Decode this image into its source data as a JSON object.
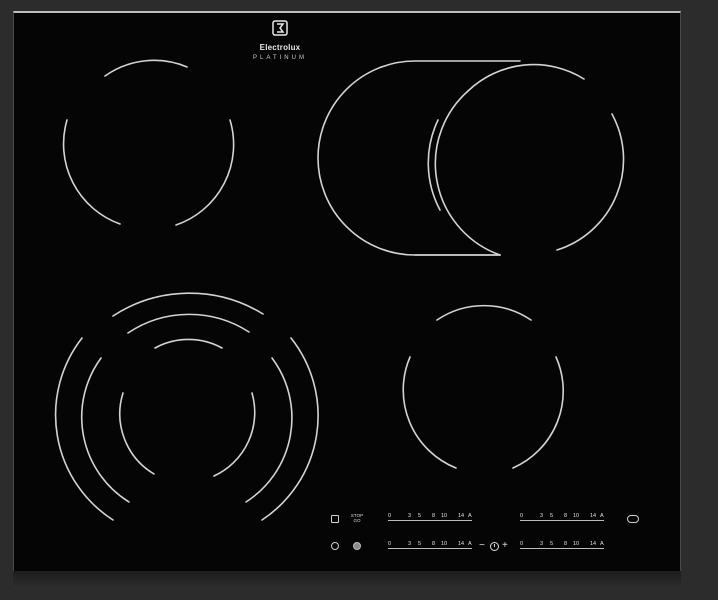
{
  "brand": {
    "name": "Electrolux",
    "series": "PLATINUM"
  },
  "zones": [
    {
      "id": "rear-left",
      "type": "single"
    },
    {
      "id": "rear-right",
      "type": "oval-extension"
    },
    {
      "id": "front-left",
      "type": "triple"
    },
    {
      "id": "front-right",
      "type": "single"
    }
  ],
  "controls": {
    "stop_label": "STOP",
    "stop_sub": "GO",
    "sliders": [
      {
        "id": "slider-top-left",
        "ticks": [
          "0",
          "3",
          "5",
          "8",
          "10",
          "14",
          "A"
        ]
      },
      {
        "id": "slider-top-right",
        "ticks": [
          "0",
          "3",
          "5",
          "8",
          "10",
          "14",
          "A"
        ]
      },
      {
        "id": "slider-bottom-left",
        "ticks": [
          "0",
          "3",
          "5",
          "8",
          "10",
          "14",
          "A"
        ]
      },
      {
        "id": "slider-bottom-right",
        "ticks": [
          "0",
          "3",
          "5",
          "8",
          "10",
          "14",
          "A"
        ]
      }
    ],
    "timer_minus": "−",
    "timer_plus": "+"
  },
  "colors": {
    "glass": "#050505",
    "markings": "#d8d8d8",
    "frame": "#bdbdbd"
  }
}
